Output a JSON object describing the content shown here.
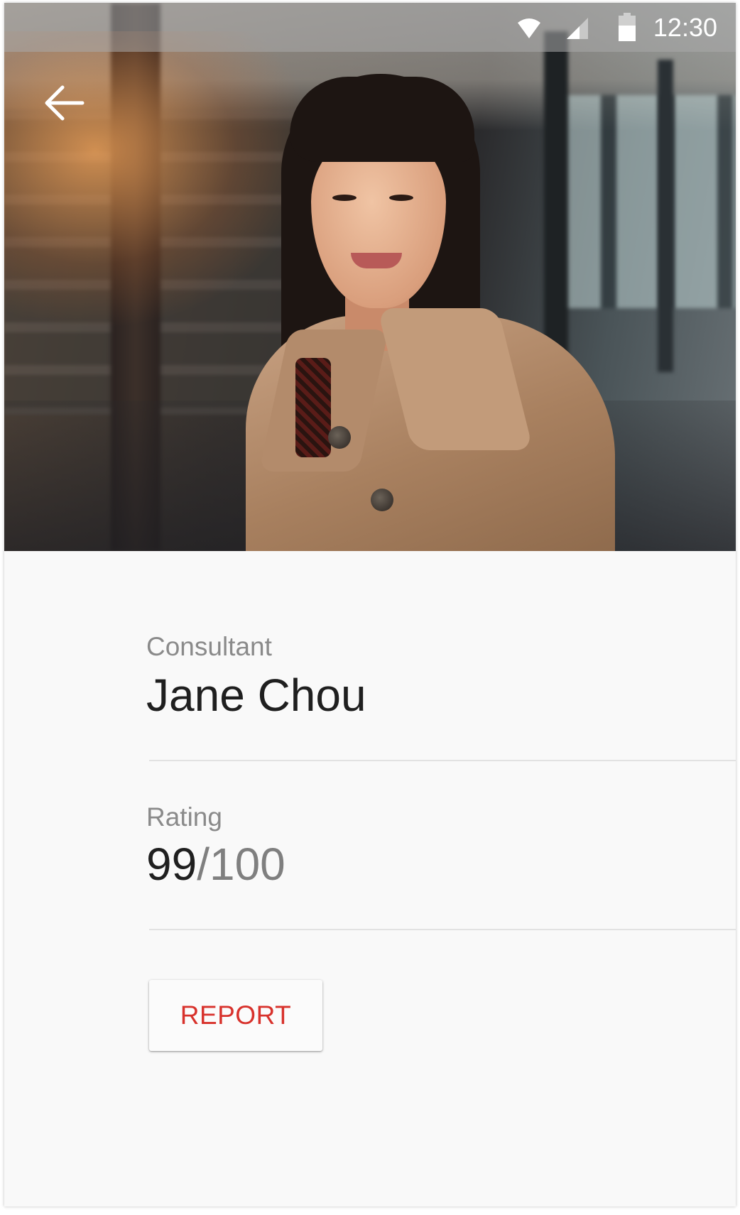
{
  "status_bar": {
    "time": "12:30",
    "icons": [
      "wifi-icon",
      "signal-icon",
      "battery-icon"
    ],
    "color": "#ffffff"
  },
  "header": {
    "back_icon": "arrow-back-icon",
    "photo": "profile-photo"
  },
  "profile": {
    "role_label": "Consultant",
    "name": "Jane Chou",
    "rating_label": "Rating",
    "rating_score": "99",
    "rating_separator": "/",
    "rating_max": "100"
  },
  "actions": {
    "report_label": "REPORT"
  },
  "colors": {
    "accent": "#d8322c",
    "background": "#f9f9f9",
    "label": "#8a8a8a",
    "text": "#1f1f1f"
  }
}
